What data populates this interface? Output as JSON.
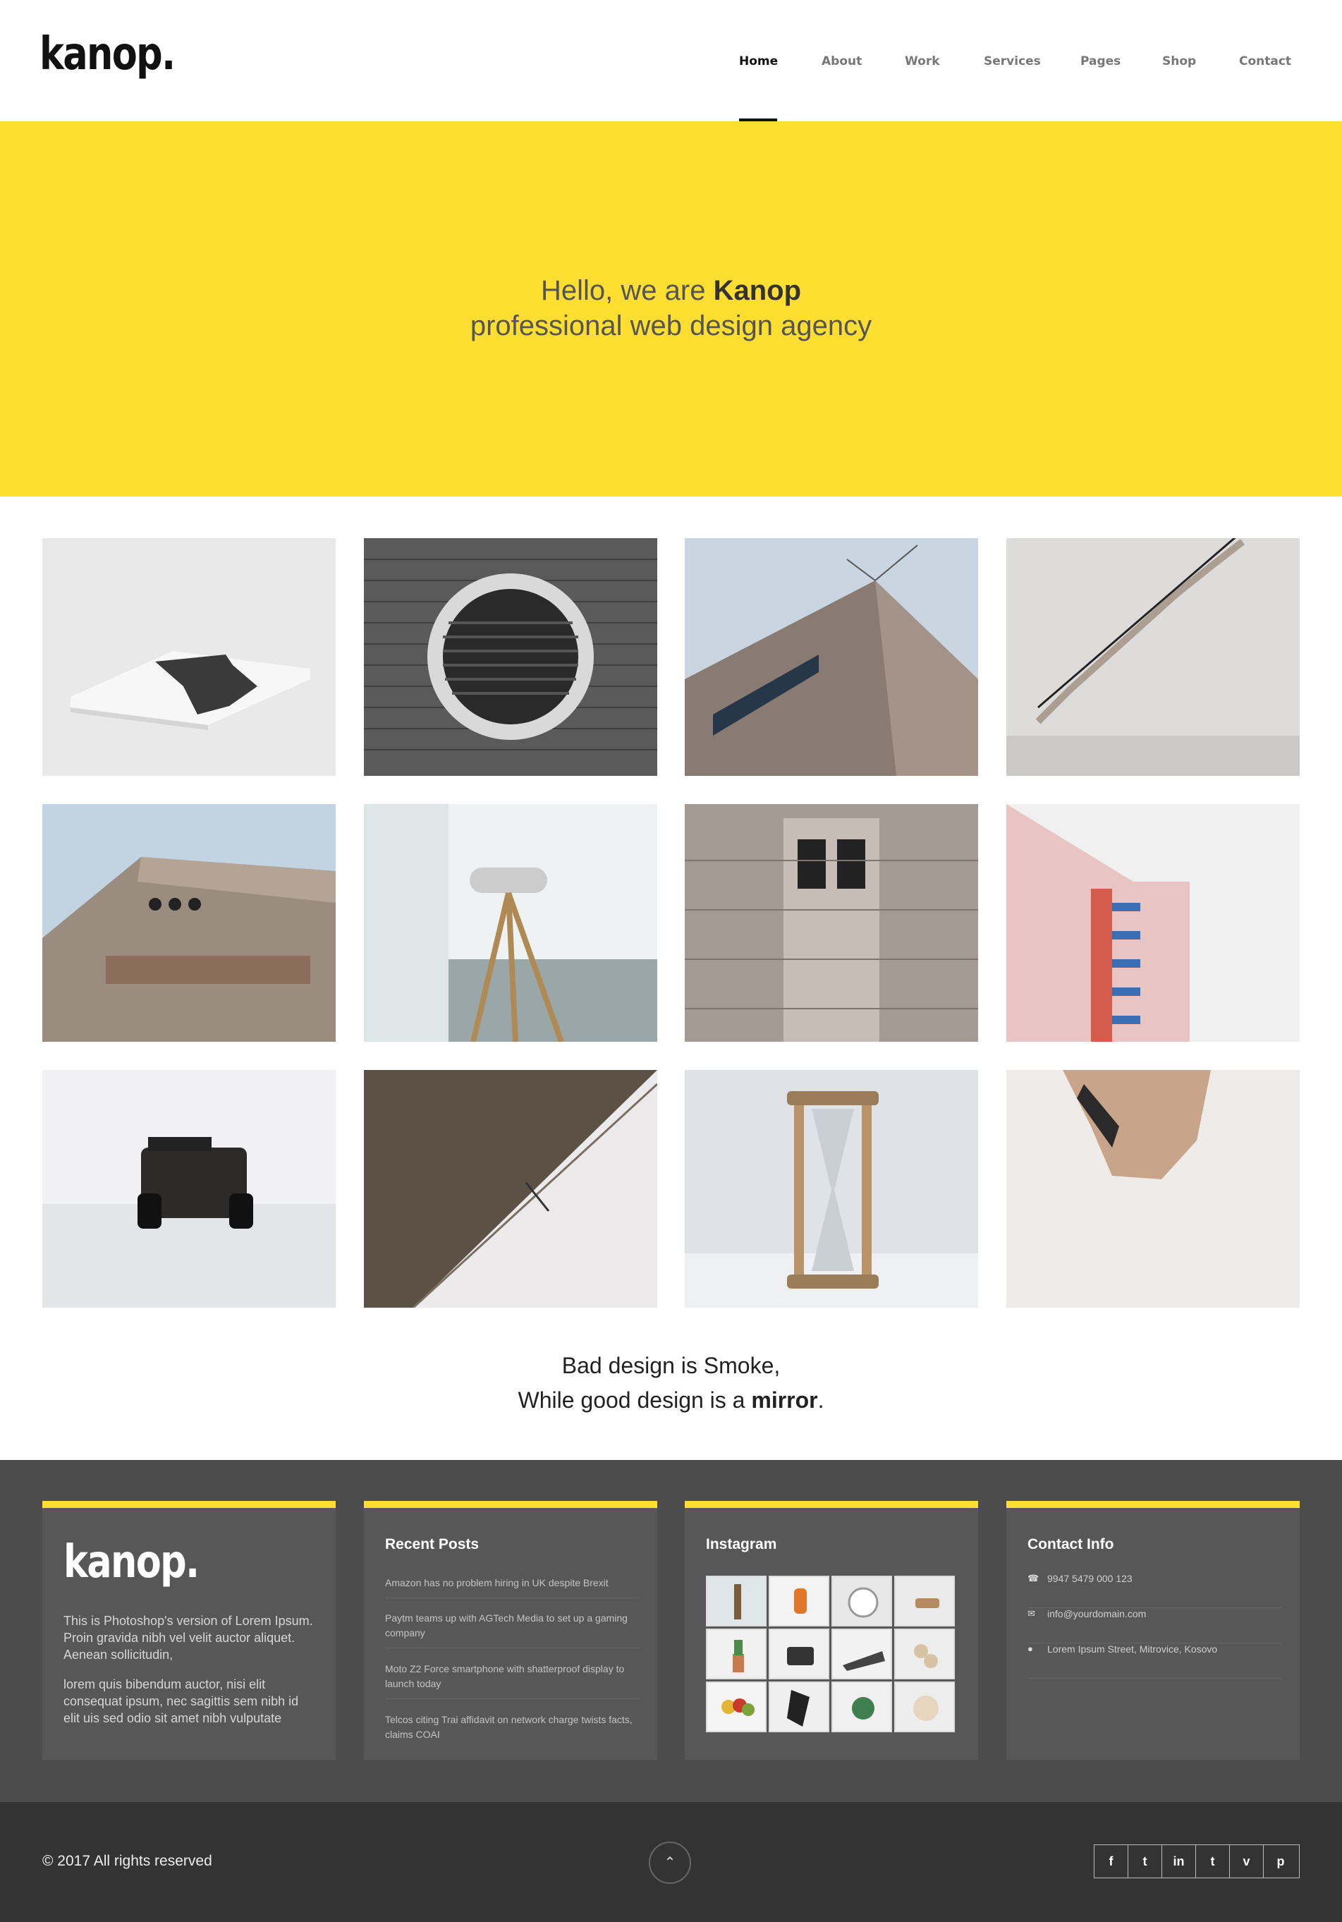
{
  "brand": {
    "logo": "kanop."
  },
  "nav": {
    "items": [
      {
        "label": "Home",
        "active": true
      },
      {
        "label": "About",
        "active": false
      },
      {
        "label": "Work",
        "active": false
      },
      {
        "label": "Services",
        "active": false
      },
      {
        "label": "Pages",
        "active": false
      },
      {
        "label": "Shop",
        "active": false
      },
      {
        "label": "Contact",
        "active": false
      }
    ]
  },
  "hero": {
    "line1_prefix": "Hello, we are",
    "line1_bold": "Kanop",
    "line2": "professional web design agency",
    "background": "#fdde31"
  },
  "gallery": {
    "items": [
      {
        "icon": "book-photo"
      },
      {
        "icon": "brick-vent-photo"
      },
      {
        "icon": "building-corner-photo"
      },
      {
        "icon": "staircase-photo"
      },
      {
        "icon": "concrete-building-photo"
      },
      {
        "icon": "telescope-photo"
      },
      {
        "icon": "door-facade-photo"
      },
      {
        "icon": "pink-building-photo"
      },
      {
        "icon": "jeep-snow-photo"
      },
      {
        "icon": "wire-photo"
      },
      {
        "icon": "hourglass-photo"
      },
      {
        "icon": "upside-down-building-photo"
      }
    ]
  },
  "quote": {
    "line1": "Bad design is Smoke,",
    "line2_prefix": "While good design is a",
    "line2_bold": "mirror",
    "line2_suffix": "."
  },
  "footer": {
    "about": {
      "logo": "kanop.",
      "para1": "This is Photoshop's version of Lorem Ipsum. Proin gravida nibh vel velit auctor aliquet. Aenean sollicitudin,",
      "para2": "lorem quis bibendum auctor, nisi elit consequat ipsum, nec sagittis sem nibh id elit uis sed odio sit amet nibh vulputate"
    },
    "recent_posts": {
      "title": "Recent Posts",
      "items": [
        "Amazon has no problem hiring in UK despite Brexit",
        "Paytm teams up with AGTech Media to set up a gaming company",
        "Moto Z2 Force smartphone with shatterproof display to launch today",
        "Telcos citing Trai affidavit on network charge twists facts, claims COAI"
      ]
    },
    "instagram": {
      "title": "Instagram"
    },
    "contact": {
      "title": "Contact Info",
      "phone": "9947 5479 000 123",
      "email": "info@yourdomain.com",
      "address": "Lorem Ipsum Street, Mitrovice, Kosovo"
    },
    "accent": "#fdde31"
  },
  "bottom": {
    "copyright": "© 2017 All rights reserved",
    "to_top": "⌃",
    "social": [
      {
        "icon": "facebook-icon",
        "glyph": "f"
      },
      {
        "icon": "twitter-icon",
        "glyph": "t"
      },
      {
        "icon": "linkedin-icon",
        "glyph": "in"
      },
      {
        "icon": "tumblr-icon",
        "glyph": "t"
      },
      {
        "icon": "vimeo-icon",
        "glyph": "v"
      },
      {
        "icon": "pinterest-icon",
        "glyph": "p"
      }
    ]
  }
}
